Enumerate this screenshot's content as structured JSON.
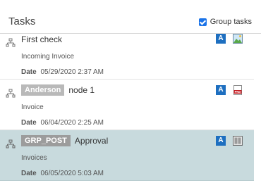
{
  "header": {
    "title": "Tasks",
    "group_toggle": {
      "label": "Group tasks",
      "checked": true
    }
  },
  "tasks": [
    {
      "tag": "",
      "name": "First check",
      "subtitle": "Incoming Invoice",
      "date_label": "Date",
      "date": "05/29/2020 2:37 AM",
      "badge": "A",
      "icon": "landscape-image-icon",
      "selected": false
    },
    {
      "tag": "Anderson",
      "name": "node 1",
      "subtitle": "Invoice",
      "date_label": "Date",
      "date": "06/04/2020 2:25 AM",
      "badge": "A",
      "icon": "pnd-document-icon",
      "icon_text": "PND",
      "selected": false
    },
    {
      "tag": "GRP_POST",
      "name": "Approval",
      "subtitle": "Invoices",
      "date_label": "Date",
      "date": "06/05/2020 5:03 AM",
      "badge": "A",
      "icon": "book-icon",
      "selected": true
    }
  ]
}
